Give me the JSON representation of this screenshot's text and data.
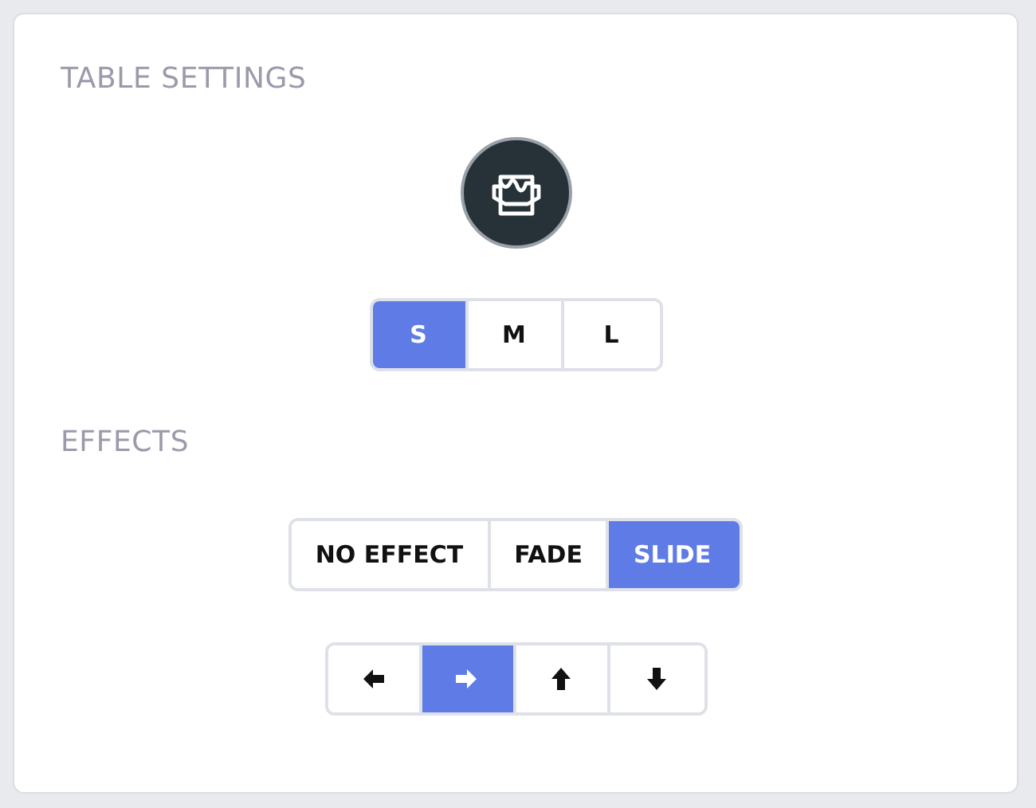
{
  "table_settings": {
    "heading": "TABLE SETTINGS",
    "sizes": [
      {
        "label": "S",
        "selected": true
      },
      {
        "label": "M",
        "selected": false
      },
      {
        "label": "L",
        "selected": false
      }
    ]
  },
  "effects": {
    "heading": "EFFECTS",
    "options": [
      {
        "label": "NO EFFECT",
        "selected": false
      },
      {
        "label": "FADE",
        "selected": false
      },
      {
        "label": "SLIDE",
        "selected": true
      }
    ],
    "directions": [
      {
        "kind": "left",
        "selected": false
      },
      {
        "kind": "right",
        "selected": true
      },
      {
        "kind": "up",
        "selected": false
      },
      {
        "kind": "down",
        "selected": false
      }
    ]
  }
}
